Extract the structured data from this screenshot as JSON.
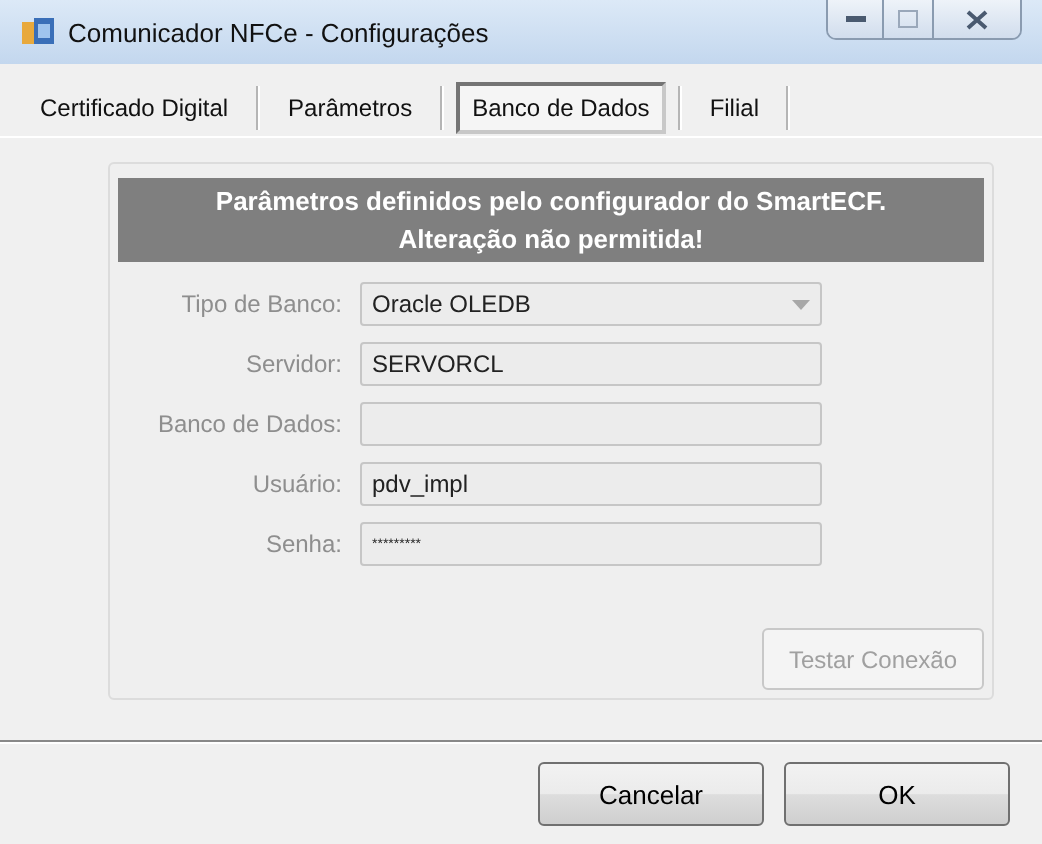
{
  "window": {
    "title": "Comunicador NFCe - Configurações"
  },
  "tabs": [
    {
      "label": "Certificado Digital",
      "selected": false
    },
    {
      "label": "Parâmetros",
      "selected": false
    },
    {
      "label": "Banco de Dados",
      "selected": true
    },
    {
      "label": "Filial",
      "selected": false
    }
  ],
  "banner": {
    "lines": [
      "Parâmetros definidos pelo configurador do SmartECF.",
      "Alteração não permitida!"
    ]
  },
  "fields": [
    {
      "label": "Tipo de Banco:",
      "value": "Oracle OLEDB",
      "kind": "dropdown",
      "disabled": true
    },
    {
      "label": "Servidor:",
      "value": "SERVORCL",
      "kind": "text",
      "disabled": true
    },
    {
      "label": "Banco de Dados:",
      "kind": "text",
      "disabled": true
    },
    {
      "label": "Usuário:",
      "value": "pdv_impl",
      "kind": "text",
      "disabled": true
    },
    {
      "label": "Senha:",
      "value": "*********",
      "kind": "password",
      "disabled": true
    }
  ],
  "test_button": {
    "label": "Testar Conexão",
    "disabled": true
  },
  "buttons": [
    {
      "label": "Cancelar"
    },
    {
      "label": "OK"
    }
  ]
}
